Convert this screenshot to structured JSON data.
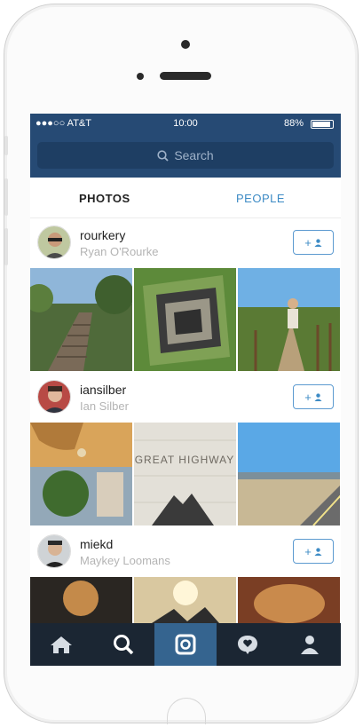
{
  "status_bar": {
    "carrier": "●●●○○ AT&T",
    "time": "10:00",
    "battery": "88%"
  },
  "search": {
    "placeholder": "Search"
  },
  "tabs": [
    {
      "label": "PHOTOS"
    },
    {
      "label": "PEOPLE"
    }
  ],
  "users": [
    {
      "username": "rourkery",
      "full_name": "Ryan O'Rourke",
      "follow_icon": "+ person"
    },
    {
      "username": "iansilber",
      "full_name": "Ian Silber",
      "follow_icon": "+ person"
    },
    {
      "username": "miekd",
      "full_name": "Maykey Loomans",
      "follow_icon": "+ person"
    }
  ],
  "photo_text": {
    "sign": "GREAT HIGHWAY"
  },
  "tab_bar": [
    "home-icon",
    "explore-search-icon",
    "camera-icon",
    "activity-heart-icon",
    "profile-icon"
  ],
  "colors": {
    "nav": "#264a74",
    "accent": "#3d8bc5",
    "tab_bar": "#1b2633",
    "tab_active": "#35648f"
  }
}
